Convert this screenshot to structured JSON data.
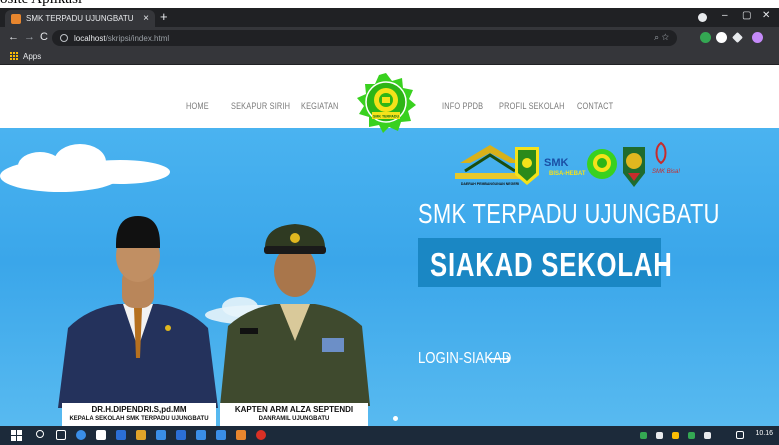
{
  "caption": {
    "text": "osite Aplikasi"
  },
  "browser": {
    "tab_title": "SMK TERPADU UJUNGBATU",
    "tab_close": "×",
    "new_tab": "+",
    "window_controls": {
      "minimize": "–",
      "maximize": "▢",
      "close": "✕"
    },
    "nav": {
      "back": "←",
      "forward": "→",
      "reload": "C"
    },
    "url_host": "localhost",
    "url_path": "/skripsi/index.html",
    "omni_icons": "⌕ ☆",
    "bookmarks": {
      "apps_label": "Apps"
    },
    "extension_colors": [
      "#34a853",
      "#ffffff",
      "#e8eaed",
      "#c58af9"
    ]
  },
  "site": {
    "nav_left": [
      "HOME",
      "SEKAPUR SIRIH",
      "KEGIATAN"
    ],
    "nav_right": [
      "INFO PPDB",
      "PROFIL SEKOLAH",
      "CONTACT"
    ],
    "logo_label": "SMK TERPADU",
    "hero": {
      "title": "SMK TERPADU UJUNGBATU",
      "box_text": "SIAKAD SEKOLAH",
      "login_link": "LOGIN-SIAKAD",
      "login_arrow": "⟶"
    },
    "people": [
      {
        "name": "DR.H.DIPENDRI.S,pd.MM",
        "role": "KEPALA SEKOLAH SMK TERPADU UJUNGBATU"
      },
      {
        "name": "KAPTEN ARM ALZA SEPTENDI",
        "role": "DANRAMIL UJUNGBATU"
      }
    ],
    "partner_logos": [
      "rokan-hulu-emblem",
      "riau-province-emblem",
      "smk-bisa-hebat-logo",
      "smk-terpadu-logo",
      "tni-ad-emblem",
      "smk-bisa-logo"
    ],
    "partner_texts": {
      "rokan": "DAERAH PEMBANGUNAN NEGERI",
      "smk_bisa": "SMK Bisa!",
      "smk_hebat": "SMK",
      "bisa_hebat": "BISA-HEBAT"
    }
  },
  "taskbar": {
    "clock": "10.16",
    "colors": {
      "accent": "#1c2a3a"
    }
  }
}
